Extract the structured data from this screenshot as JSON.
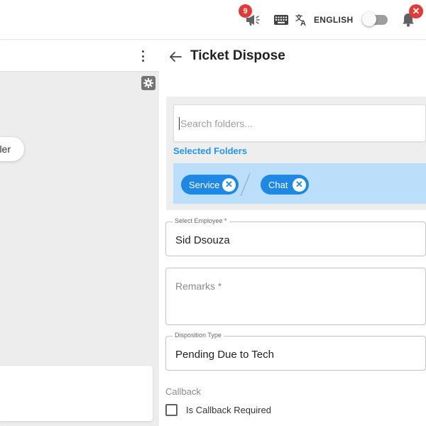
{
  "topbar": {
    "announcement_count": "9",
    "language_label": "ENGLISH",
    "notification_badge": "✕"
  },
  "left_panel": {
    "partial_chip_text": "ler"
  },
  "ticket_dispose": {
    "title": "Ticket Dispose",
    "search": {
      "placeholder": "Search folders...",
      "value": ""
    },
    "selected_folders_label": "Selected Folders",
    "selected_folders": [
      {
        "label": "Service"
      },
      {
        "label": "Chat"
      }
    ],
    "employee": {
      "label": "Select Employee *",
      "value": "Sid Dsouza"
    },
    "remarks": {
      "placeholder": "Remarks *",
      "value": ""
    },
    "disposition": {
      "label": "Disposition Type",
      "value": "Pending Due to Tech"
    },
    "callback": {
      "section_label": "Callback",
      "checkbox_label": "Is Callback Required",
      "checked": false
    }
  },
  "colors": {
    "chip_blue": "#1e88e5",
    "selected_band": "#bbdefb",
    "link_blue": "#2196f3",
    "badge_red": "#e53935"
  }
}
